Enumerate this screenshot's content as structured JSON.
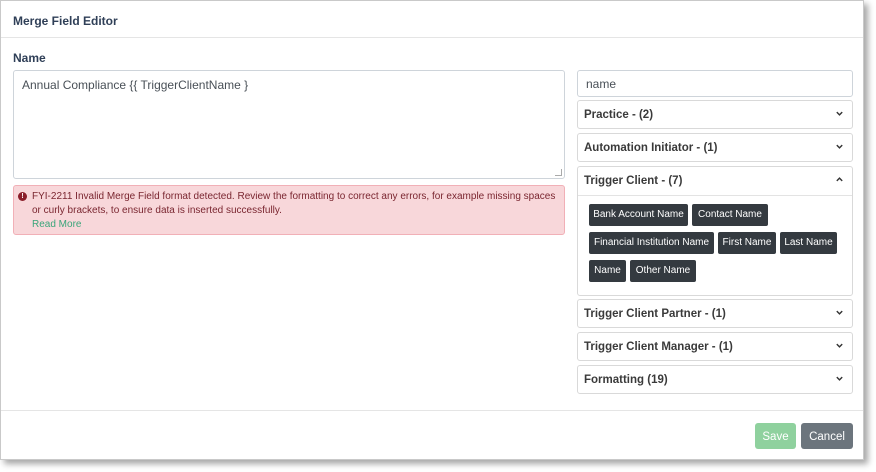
{
  "dialog": {
    "title": "Merge Field Editor",
    "name_label": "Name",
    "name_value": "Annual Compliance {{ TriggerClientName }",
    "error": {
      "message": "FYI-2211 Invalid Merge Field format detected. Review the formatting to correct any errors, for example missing spaces or curly brackets, to ensure data is inserted successfully.",
      "link": "Read More",
      "icon": "exclamation-circle-icon"
    }
  },
  "search": {
    "value": "name"
  },
  "groups": [
    {
      "label": "Practice - (2)",
      "expanded": false
    },
    {
      "label": "Automation Initiator - (1)",
      "expanded": false
    },
    {
      "label": "Trigger Client - (7)",
      "expanded": true,
      "fields": [
        "Bank Account Name",
        "Contact Name",
        "Financial Institution Name",
        "First Name",
        "Last Name",
        "Name",
        "Other Name"
      ]
    },
    {
      "label": "Trigger Client Partner - (1)",
      "expanded": false
    },
    {
      "label": "Trigger Client Manager - (1)",
      "expanded": false
    },
    {
      "label": "Formatting (19)",
      "expanded": false
    }
  ],
  "footer": {
    "save_label": "Save",
    "cancel_label": "Cancel"
  },
  "colors": {
    "chip_bg": "#343a40",
    "save_bg": "#8fd19e",
    "cancel_bg": "#6c757d",
    "alert_bg": "#f8d7da"
  }
}
